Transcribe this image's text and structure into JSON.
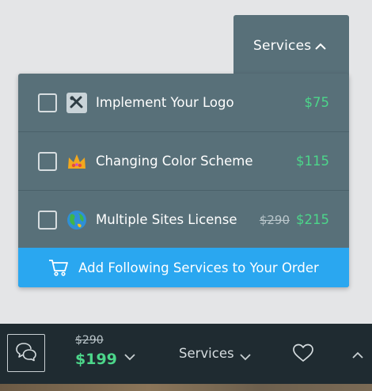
{
  "dropdown": {
    "tab_label": "Services",
    "items": [
      {
        "icon": "tools-icon",
        "label": "Implement Your Logo",
        "price": "$75",
        "old_price": ""
      },
      {
        "icon": "crown-icon",
        "label": "Changing Color Scheme",
        "price": "$115",
        "old_price": ""
      },
      {
        "icon": "globe-icon",
        "label": "Multiple Sites License",
        "price": "$215",
        "old_price": "$290"
      }
    ],
    "add_button_label": "Add Following Services to Your Order"
  },
  "bottom_bar": {
    "old_price": "$290",
    "price": "$199",
    "services_label": "Services"
  },
  "colors": {
    "panel": "#587079",
    "accent_blue": "#2aa7f0",
    "price_green": "#4cd68a",
    "bar": "#1f2b31"
  }
}
